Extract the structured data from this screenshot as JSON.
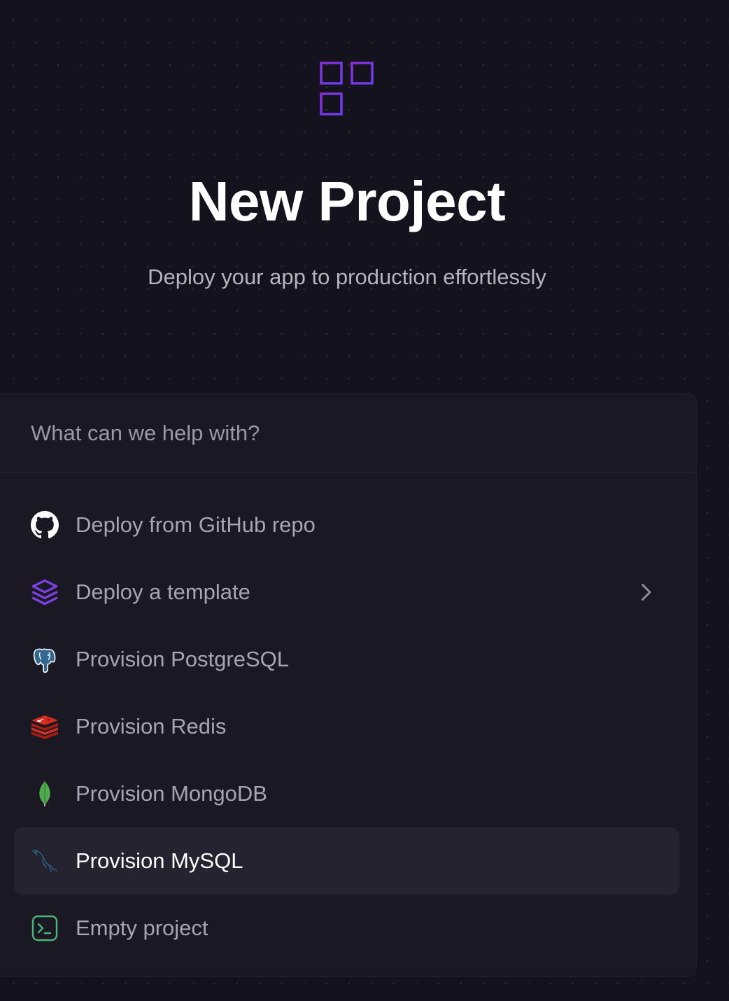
{
  "header": {
    "logo_icon": "grid-plus-icon",
    "title": "New Project",
    "subtitle": "Deploy your app to production effortlessly"
  },
  "search": {
    "placeholder": "What can we help with?",
    "value": ""
  },
  "options": [
    {
      "label": "Deploy from GitHub repo",
      "icon": "github-icon",
      "has_chevron": false,
      "active": false
    },
    {
      "label": "Deploy a template",
      "icon": "layers-icon",
      "has_chevron": true,
      "active": false
    },
    {
      "label": "Provision PostgreSQL",
      "icon": "postgresql-icon",
      "has_chevron": false,
      "active": false
    },
    {
      "label": "Provision Redis",
      "icon": "redis-icon",
      "has_chevron": false,
      "active": false
    },
    {
      "label": "Provision MongoDB",
      "icon": "mongodb-icon",
      "has_chevron": false,
      "active": false
    },
    {
      "label": "Provision MySQL",
      "icon": "mysql-icon",
      "has_chevron": false,
      "active": true
    },
    {
      "label": "Empty project",
      "icon": "terminal-icon",
      "has_chevron": false,
      "active": false
    }
  ],
  "colors": {
    "background": "#14121d",
    "panel": "#1a1823",
    "accent_purple": "#7b3fe4",
    "highlight_row": "#252330"
  }
}
